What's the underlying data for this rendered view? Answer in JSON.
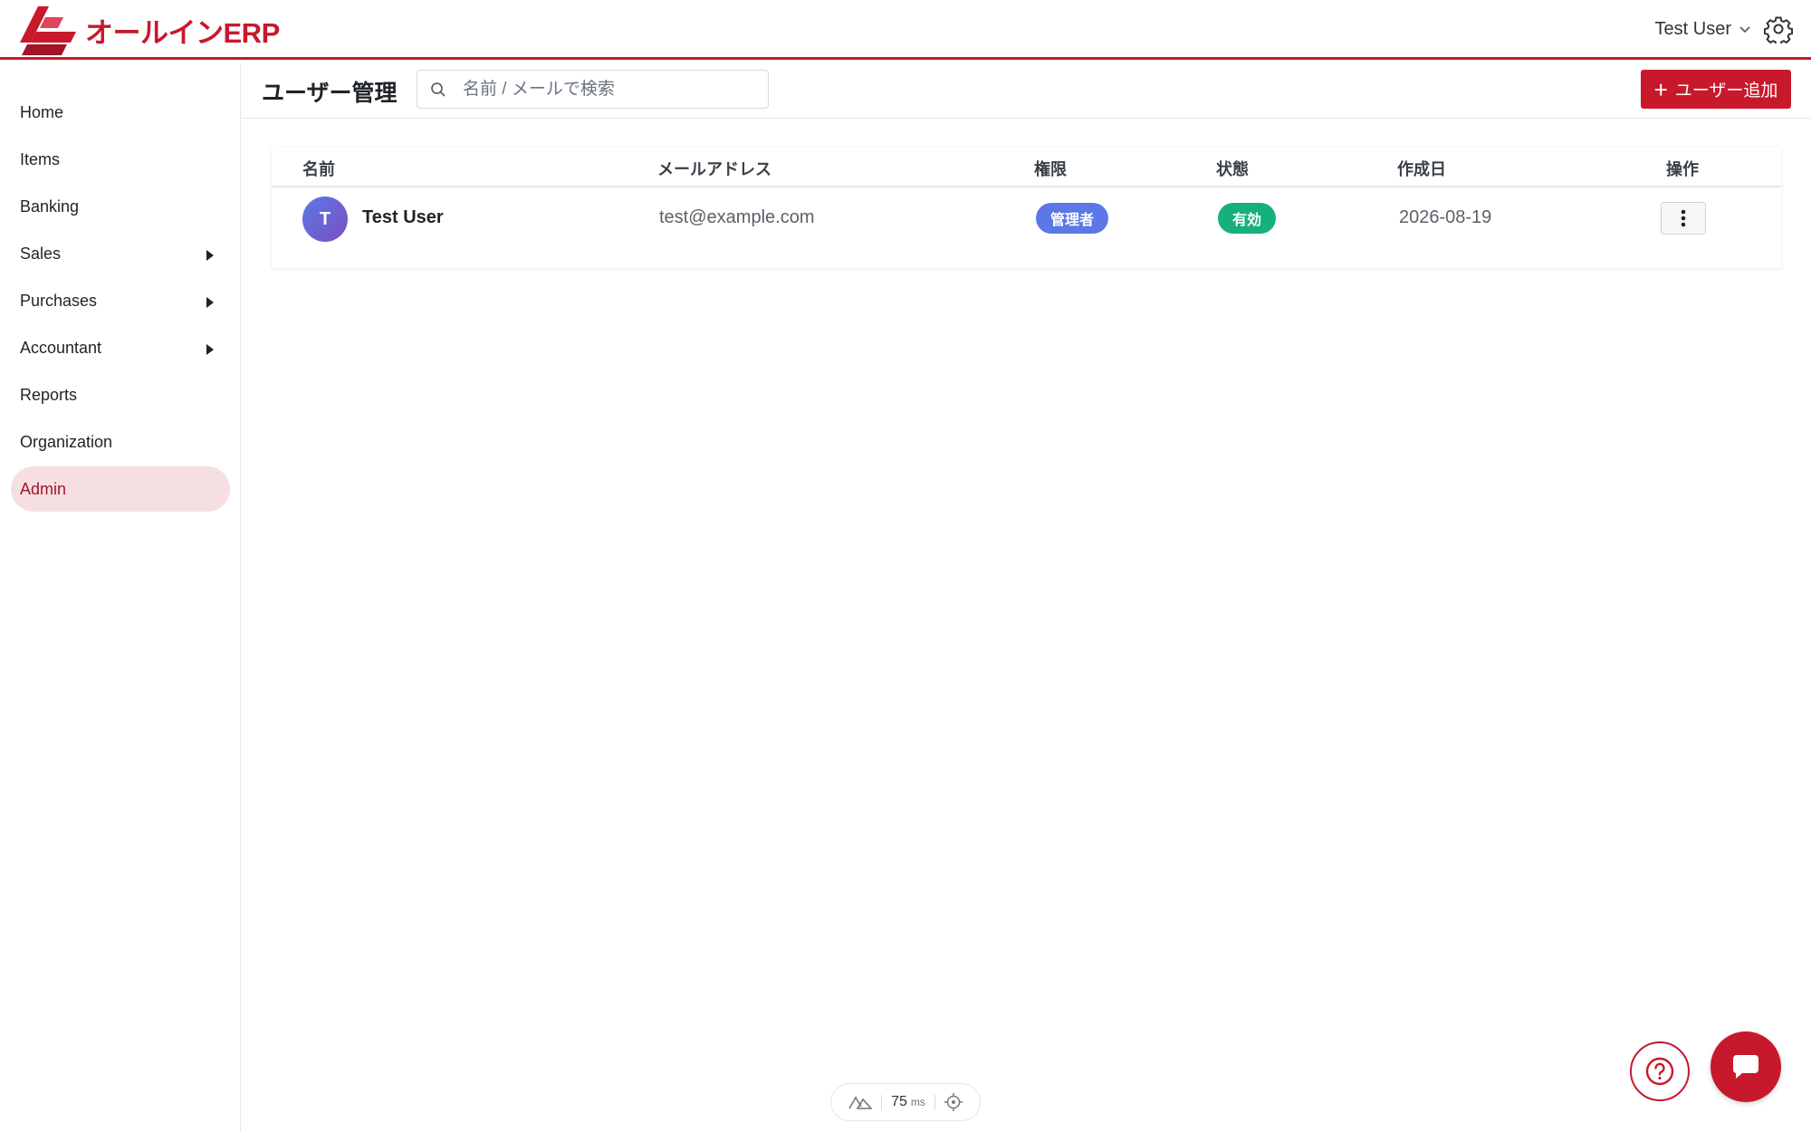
{
  "brand": {
    "name": "オールインERP",
    "accent_color": "#c8192c",
    "logo_icon": "logo-mark-icon"
  },
  "header": {
    "user_name": "Test User",
    "user_menu_icon": "chevron-down-icon",
    "settings_icon": "gear-icon"
  },
  "sidebar": {
    "items": [
      {
        "label": "Home",
        "has_submenu": false,
        "active": false
      },
      {
        "label": "Items",
        "has_submenu": false,
        "active": false
      },
      {
        "label": "Banking",
        "has_submenu": false,
        "active": false
      },
      {
        "label": "Sales",
        "has_submenu": true,
        "active": false
      },
      {
        "label": "Purchases",
        "has_submenu": true,
        "active": false
      },
      {
        "label": "Accountant",
        "has_submenu": true,
        "active": false
      },
      {
        "label": "Reports",
        "has_submenu": false,
        "active": false
      },
      {
        "label": "Organization",
        "has_submenu": false,
        "active": false
      },
      {
        "label": "Admin",
        "has_submenu": false,
        "active": true
      }
    ]
  },
  "page": {
    "title": "ユーザー管理",
    "search_placeholder": "名前 / メールで検索",
    "add_button_label": "ユーザー追加"
  },
  "table": {
    "columns": [
      "名前",
      "メールアドレス",
      "権限",
      "状態",
      "作成日",
      "操作"
    ],
    "rows": [
      {
        "avatar_initial": "T",
        "name": "Test User",
        "email": "test@example.com",
        "role": "管理者",
        "role_color": "#5b78e6",
        "status": "有効",
        "status_color": "#16b07a",
        "created": "2026-08-19",
        "actions_icon": "kebab-menu-icon"
      }
    ]
  },
  "perf": {
    "value": "75",
    "unit": "ms"
  },
  "floating": {
    "help_icon": "help-icon",
    "chat_icon": "chat-icon"
  }
}
